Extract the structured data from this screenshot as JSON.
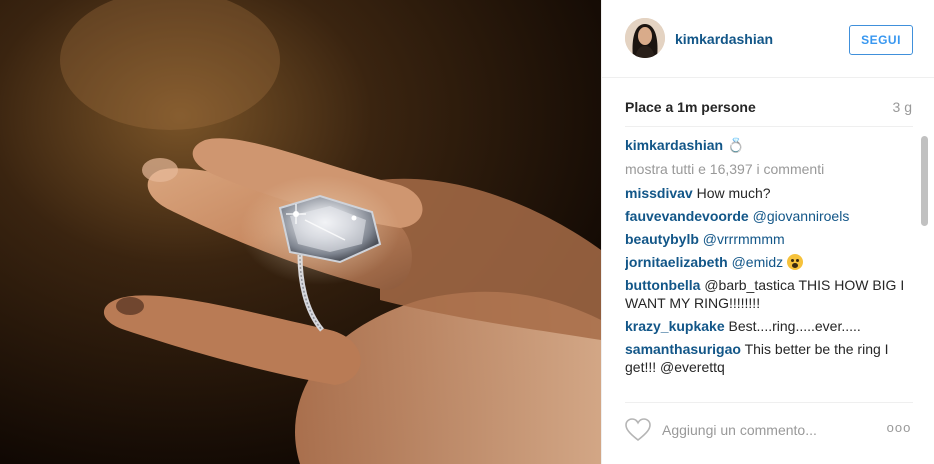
{
  "post": {
    "author": "kimkardashian",
    "follow_label": "SEGUI",
    "likes_text": "Place a 1m persone",
    "time_ago": "3 g",
    "caption_icon": "ring-icon",
    "view_all_text": "mostra tutti e 16,397 i commenti"
  },
  "comments": [
    {
      "user": "missdivav",
      "text": "How much?"
    },
    {
      "user": "fauvevandevoorde",
      "text": "@giovanniroels"
    },
    {
      "user": "beautybylb",
      "text": "@vrrrmmmm"
    },
    {
      "user": "jornitaelizabeth",
      "text": "@emidz",
      "emoji": "fearful-face-icon"
    },
    {
      "user": "buttonbella",
      "text": "@barb_tastica THIS HOW BIG I WANT MY RING!!!!!!!!"
    },
    {
      "user": "krazy_kupkake",
      "text": "Best....ring.....ever....."
    },
    {
      "user": "samanthasurigao",
      "text": "This better be the ring I get!!! @everettq"
    }
  ],
  "composer": {
    "placeholder": "Aggiungi un commento...",
    "more_label": "ooo"
  },
  "colors": {
    "username": "#125688",
    "follow_accent": "#3897f0",
    "muted": "#999999"
  }
}
